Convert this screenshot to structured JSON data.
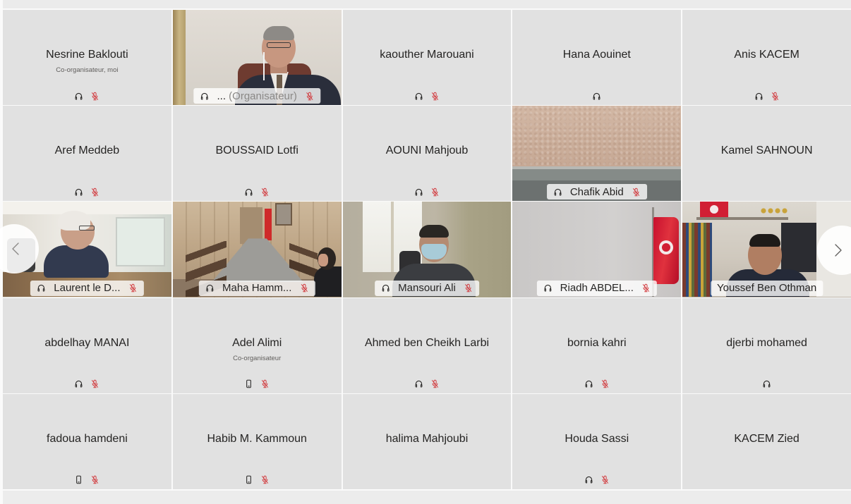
{
  "grid": {
    "tiles": [
      {
        "name": "Nesrine Baklouti",
        "role": "Co-organisateur, moi",
        "icons": [
          "headset-icon",
          "mic-off-icon"
        ]
      },
      {
        "name": "...",
        "role": "(Organisateur)",
        "video": true,
        "icons": [
          "headset-icon",
          "mic-off-icon"
        ]
      },
      {
        "name": "kaouther Marouani",
        "icons": [
          "headset-icon",
          "mic-off-icon"
        ]
      },
      {
        "name": "Hana Aouinet",
        "icons": [
          "headset-icon"
        ]
      },
      {
        "name": "Anis KACEM",
        "icons": [
          "headset-icon",
          "mic-off-icon"
        ]
      },
      {
        "name": "Aref Meddeb",
        "icons": [
          "headset-icon",
          "mic-off-icon"
        ]
      },
      {
        "name": "BOUSSAID Lotfi",
        "icons": [
          "headset-icon",
          "mic-off-icon"
        ]
      },
      {
        "name": "AOUNI Mahjoub",
        "icons": [
          "headset-icon",
          "mic-off-icon"
        ]
      },
      {
        "name": "Chafik Abid",
        "video": true,
        "icons": [
          "headset-icon",
          "mic-off-icon"
        ]
      },
      {
        "name": "Kamel SAHNOUN",
        "icons": []
      },
      {
        "name": "Laurent le D...",
        "video": true,
        "icons": [
          "headset-icon",
          "mic-off-icon"
        ]
      },
      {
        "name": "Maha Hamm...",
        "video": true,
        "icons": [
          "headset-icon",
          "mic-off-icon"
        ]
      },
      {
        "name": "Mansouri Ali",
        "video": true,
        "icons": [
          "headset-icon",
          "mic-off-icon"
        ]
      },
      {
        "name": "Riadh ABDEL...",
        "video": true,
        "icons": [
          "headset-icon",
          "mic-off-icon"
        ]
      },
      {
        "name": "Youssef Ben Othman",
        "video": true,
        "icons": []
      },
      {
        "name": "abdelhay MANAI",
        "icons": [
          "headset-icon",
          "mic-off-icon"
        ]
      },
      {
        "name": "Adel Alimi",
        "role": "Co-organisateur",
        "icons": [
          "phone-icon",
          "mic-off-icon"
        ]
      },
      {
        "name": "Ahmed ben Cheikh Larbi",
        "icons": [
          "headset-icon",
          "mic-off-icon"
        ]
      },
      {
        "name": "bornia kahri",
        "icons": [
          "headset-icon",
          "mic-off-icon"
        ]
      },
      {
        "name": "djerbi mohamed",
        "icons": [
          "headset-icon"
        ]
      },
      {
        "name": "fadoua hamdeni",
        "icons": [
          "phone-icon",
          "mic-off-icon"
        ]
      },
      {
        "name": "Habib M. Kammoun",
        "icons": [
          "phone-icon",
          "mic-off-icon"
        ]
      },
      {
        "name": "halima Mahjoubi",
        "icons": []
      },
      {
        "name": "Houda Sassi",
        "icons": [
          "headset-icon",
          "mic-off-icon"
        ]
      },
      {
        "name": "KACEM Zied",
        "icons": []
      }
    ]
  },
  "carousel": {
    "prev_icon": "chevron-left-icon",
    "next_icon": "chevron-right-icon"
  },
  "colors": {
    "tile_background": "#e1e1e1",
    "muted_red": "#d13438",
    "text": "#252423"
  }
}
